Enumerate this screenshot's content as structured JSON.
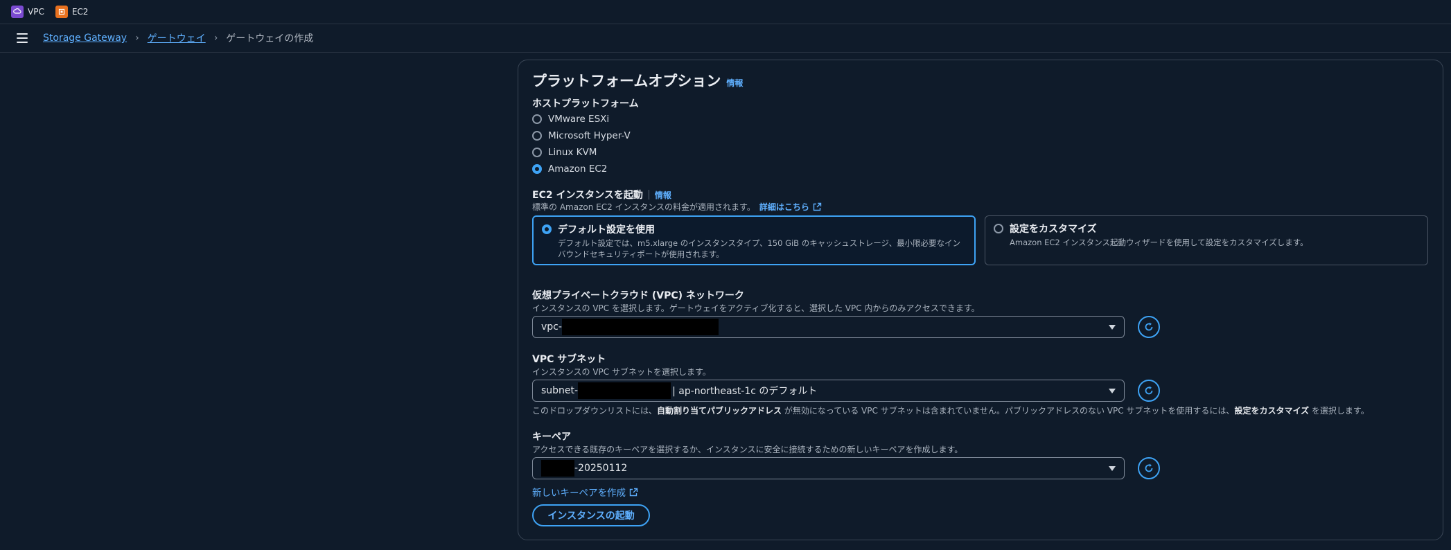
{
  "services": [
    {
      "label": "VPC",
      "icon": "vpc-icon",
      "color": "#7b4bd1"
    },
    {
      "label": "EC2",
      "icon": "ec2-icon",
      "color": "#e8711f"
    }
  ],
  "breadcrumb": [
    "Storage Gateway",
    "ゲートウェイ",
    "ゲートウェイの作成"
  ],
  "panel": {
    "title": "プラットフォームオプション",
    "info": "情報"
  },
  "host": {
    "label": "ホストプラットフォーム",
    "options": [
      "VMware ESXi",
      "Microsoft Hyper-V",
      "Linux KVM",
      "Amazon EC2"
    ],
    "selected": "Amazon EC2"
  },
  "ec2": {
    "label": "EC2 インスタンスを起動",
    "info": "情報",
    "desc": "標準の Amazon EC2 インスタンスの料金が適用されます。",
    "learn_more": "詳細はこちら",
    "default_title": "デフォルト設定を使用",
    "default_desc": "デフォルト設定では、m5.xlarge のインスタンスタイプ、150 GiB のキャッシュストレージ、最小限必要なインバウンドセキュリティポートが使用されます。",
    "custom_title": "設定をカスタマイズ",
    "custom_desc": "Amazon EC2 インスタンス起動ウィザードを使用して設定をカスタマイズします。"
  },
  "vpc": {
    "label": "仮想プライベートクラウド (VPC) ネットワーク",
    "desc": "インスタンスの VPC を選択します。ゲートウェイをアクティブ化すると、選択した VPC 内からのみアクセスできます。",
    "value_prefix": "vpc-"
  },
  "subnet": {
    "label": "VPC サブネット",
    "desc": "インスタンスの VPC サブネットを選択します。",
    "value_prefix": "subnet-",
    "value_suffix": "| ap-northeast-1c のデフォルト",
    "note_1": "このドロップダウンリストには、",
    "note_bold_1": "自動割り当てパブリックアドレス",
    "note_2": " が無効になっている VPC サブネットは含まれていません。パブリックアドレスのない VPC サブネットを使用するには、",
    "note_bold_2": "設定をカスタマイズ",
    "note_3": " を選択します。"
  },
  "keypair": {
    "label": "キーペア",
    "desc": "アクセスできる既存のキーペアを選択するか、インスタンスに安全に接続するための新しいキーペアを作成します。",
    "value_suffix": "-20250112",
    "create_link": "新しいキーペアを作成"
  },
  "launch_button": "インスタンスの起動"
}
